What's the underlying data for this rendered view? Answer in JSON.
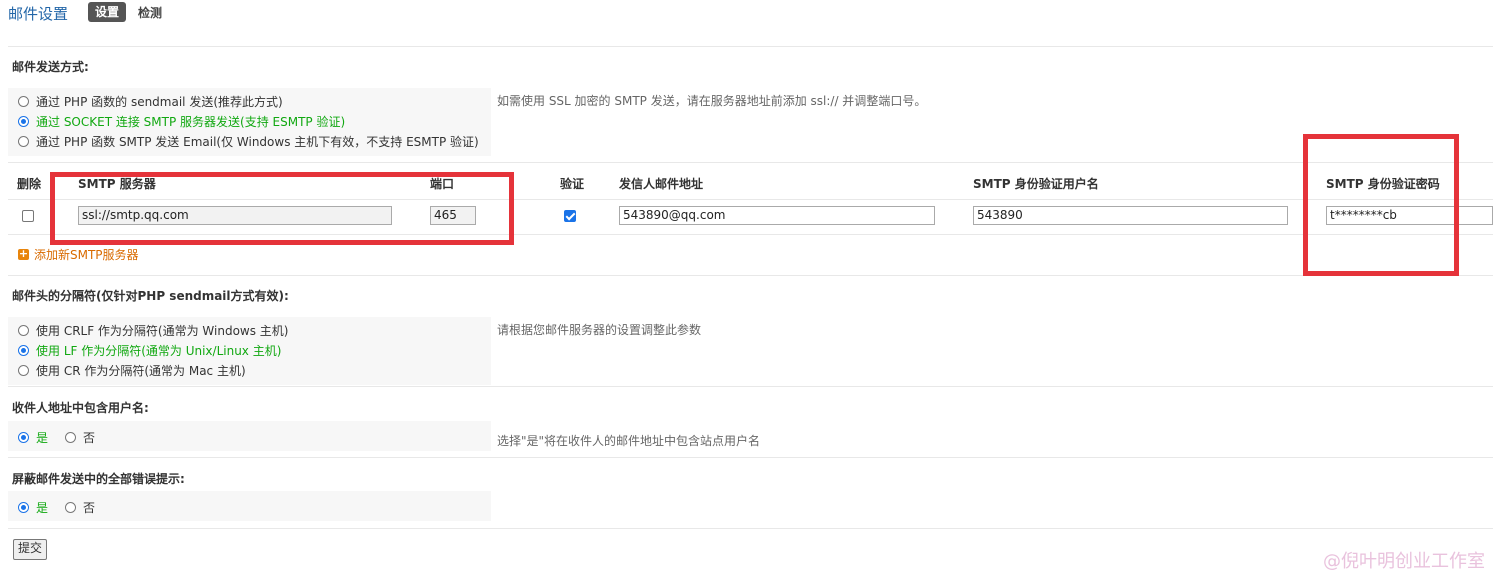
{
  "header": {
    "title": "邮件设置",
    "tab_settings": "设置",
    "tab_check": "检测"
  },
  "send_method": {
    "title": "邮件发送方式:",
    "options": [
      "通过 PHP 函数的 sendmail 发送(推荐此方式)",
      "通过 SOCKET 连接 SMTP 服务器发送(支持 ESMTP 验证)",
      "通过 PHP 函数 SMTP 发送 Email(仅 Windows 主机下有效，不支持 ESMTP 验证)"
    ],
    "selected_index": 1,
    "hint": "如需使用 SSL 加密的 SMTP 发送，请在服务器地址前添加 ssl:// 并调整端口号。"
  },
  "smtp_table": {
    "headers": {
      "delete": "删除",
      "server": "SMTP 服务器",
      "port": "端口",
      "auth": "验证",
      "from": "发信人邮件地址",
      "username": "SMTP 身份验证用户名",
      "password": "SMTP 身份验证密码"
    },
    "row": {
      "server": "ssl://smtp.qq.com",
      "port": "465",
      "auth_checked": true,
      "from": "543890@qq.com",
      "username": "543890",
      "password": "t********cb"
    },
    "add_label": "添加新SMTP服务器"
  },
  "separator": {
    "title": "邮件头的分隔符(仅针对PHP sendmail方式有效):",
    "options": [
      "使用 CRLF 作为分隔符(通常为 Windows 主机)",
      "使用 LF 作为分隔符(通常为 Unix/Linux 主机)",
      "使用 CR 作为分隔符(通常为 Mac 主机)"
    ],
    "selected_index": 1,
    "hint": "请根据您邮件服务器的设置调整此参数"
  },
  "include_username": {
    "title": "收件人地址中包含用户名:",
    "yes": "是",
    "no": "否",
    "hint": "选择\"是\"将在收件人的邮件地址中包含站点用户名"
  },
  "silent_errors": {
    "title": "屏蔽邮件发送中的全部错误提示:",
    "yes": "是",
    "no": "否"
  },
  "submit_label": "提交",
  "watermark": "@倪叶明创业工作室",
  "colors": {
    "accent": "#2366a8",
    "selected_option": "#11a811",
    "highlight_box": "#e5333a",
    "add_link": "#d96b00"
  }
}
